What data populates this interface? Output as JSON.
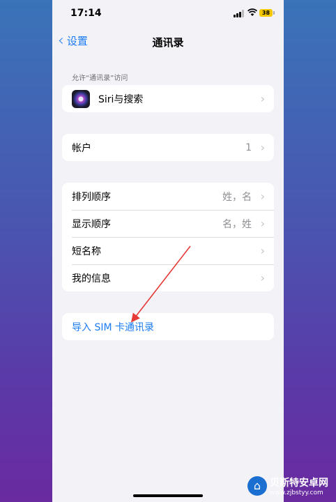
{
  "status": {
    "time": "17:14",
    "battery": "38"
  },
  "nav": {
    "back_label": "设置",
    "title": "通讯录"
  },
  "section_header": "允许“通讯录”访问",
  "siri_row": {
    "label": "Siri与搜索"
  },
  "account_row": {
    "label": "帐户",
    "value": "1"
  },
  "settings_rows": [
    {
      "label": "排列顺序",
      "value": "姓，名"
    },
    {
      "label": "显示顺序",
      "value": "名，姓"
    },
    {
      "label": "短名称",
      "value": ""
    },
    {
      "label": "我的信息",
      "value": ""
    }
  ],
  "import_row": {
    "label": "导入 SIM 卡通讯录"
  },
  "watermark": {
    "title": "贝斯特安卓网",
    "url": "www.zjbstyy.com"
  },
  "colors": {
    "accent": "#1a7cf2",
    "annotation": "#e53935"
  }
}
